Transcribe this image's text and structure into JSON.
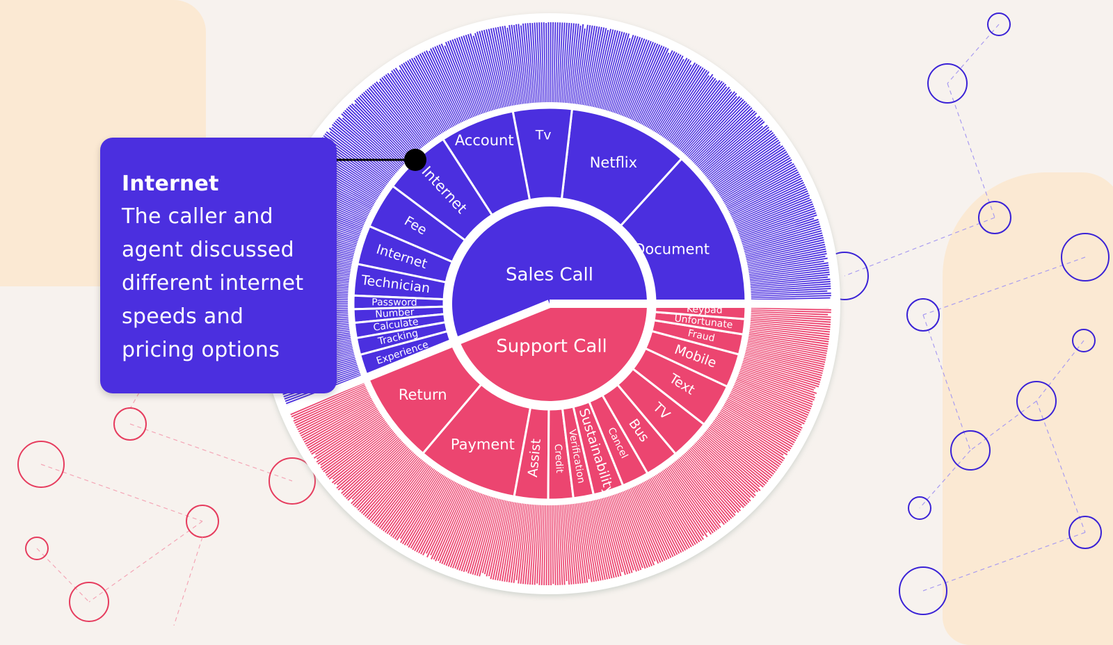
{
  "colors": {
    "background": "#f7f2ee",
    "blob": "#fbe9d3",
    "sales": "#4b2fdf",
    "support": "#ec4570",
    "divider": "#ffffff",
    "pointer": "#000000"
  },
  "tooltip": {
    "title": "Internet",
    "body": "The caller and agent discussed different internet speeds and pricing options"
  },
  "chart_data": {
    "type": "sunburst",
    "title": "",
    "root_labels": [
      "Sales Call",
      "Support Call"
    ],
    "series": [
      {
        "name": "Sales Call",
        "color": "#4b2fdf",
        "share_deg": 202,
        "children": [
          {
            "label": "Document",
            "value": 47.7
          },
          {
            "label": "Netflix",
            "value": 35.7
          },
          {
            "label": "Tv",
            "value": 17.4
          },
          {
            "label": "Account",
            "value": 22.1
          },
          {
            "label": "Internet",
            "value": 20.2,
            "highlighted": true
          },
          {
            "label": "Fee",
            "value": 13.6
          },
          {
            "label": "Internet",
            "value": 11.6
          },
          {
            "label": "Technician",
            "value": 9.3
          },
          {
            "label": "Password",
            "value": 4.0
          },
          {
            "label": "Number",
            "value": 4.0
          },
          {
            "label": "Calculate",
            "value": 4.5
          },
          {
            "label": "Tracking",
            "value": 5.0
          },
          {
            "label": "Experience",
            "value": 6.9
          }
        ]
      },
      {
        "name": "Support Call",
        "color": "#ec4570",
        "share_deg": 158,
        "children": [
          {
            "label": "Return",
            "value": 27.8
          },
          {
            "label": "Payment",
            "value": 29.8
          },
          {
            "label": "Assist",
            "value": 10.0
          },
          {
            "label": "Credit",
            "value": 7.4
          },
          {
            "label": "Verification",
            "value": 6.0
          },
          {
            "label": "Sustainability",
            "value": 9.0
          },
          {
            "label": "Cancel",
            "value": 8.0
          },
          {
            "label": "Bus",
            "value": 10.0
          },
          {
            "label": "TV",
            "value": 12.0
          },
          {
            "label": "Text",
            "value": 13.0
          },
          {
            "label": "Mobile",
            "value": 10.0
          },
          {
            "label": "Fraud",
            "value": 6.0
          },
          {
            "label": "Unfortunate",
            "value": 4.5
          },
          {
            "label": "Keypad",
            "value": 4.5
          }
        ]
      }
    ],
    "outer_ring": "many thin leaf slices per category (unlabeled)",
    "legend": "none"
  }
}
